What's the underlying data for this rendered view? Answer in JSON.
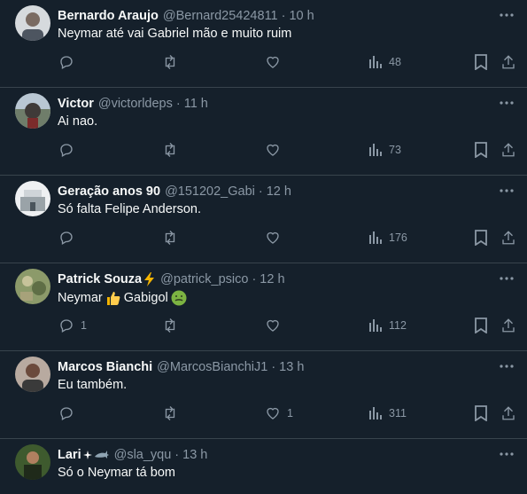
{
  "tweets": [
    {
      "name": "Bernardo Araujo",
      "handle": "@Bernard25424811",
      "time": "10 h",
      "text": "Neymar até vai Gabriel mão e muito ruim",
      "replies": "",
      "retweets": "",
      "likes": "",
      "views": "48",
      "avatar_color": "#cfd3d6"
    },
    {
      "name": "Victor",
      "handle": "@victorldeps",
      "time": "11 h",
      "text": "Ai nao.",
      "replies": "",
      "retweets": "",
      "likes": "",
      "views": "73",
      "avatar_color": "#8aa3b8"
    },
    {
      "name": "Geração anos 90",
      "handle": "@151202_Gabi",
      "time": "12 h",
      "text": "Só falta Felipe Anderson.",
      "replies": "",
      "retweets": "",
      "likes": "",
      "views": "176",
      "avatar_color": "#e9ecef"
    },
    {
      "name": "Patrick Souza",
      "handle": "@patrick_psico",
      "time": "12 h",
      "text_before": "Neymar",
      "text_middle": "Gabigol",
      "replies": "1",
      "retweets": "",
      "likes": "",
      "views": "112",
      "avatar_color": "#7d8f5c"
    },
    {
      "name": "Marcos Bianchi",
      "handle": "@MarcosBianchiJ1",
      "time": "13 h",
      "text": "Eu também.",
      "replies": "",
      "retweets": "",
      "likes": "1",
      "views": "311",
      "avatar_color": "#a58f84"
    },
    {
      "name": "Lari",
      "handle": "@sla_yqu",
      "time": "13 h",
      "text": "Só o Neymar tá bom",
      "avatar_color": "#4a6a3a"
    }
  ],
  "colors": {
    "background": "#15202b",
    "text": "#f7f9f9",
    "secondary": "#8b98a5",
    "divider": "#38444d"
  },
  "icons": {
    "reply": "reply-icon",
    "retweet": "retweet-icon",
    "like": "heart-icon",
    "views": "views-icon",
    "bookmark": "bookmark-icon",
    "share": "share-icon",
    "more": "more-icon"
  }
}
